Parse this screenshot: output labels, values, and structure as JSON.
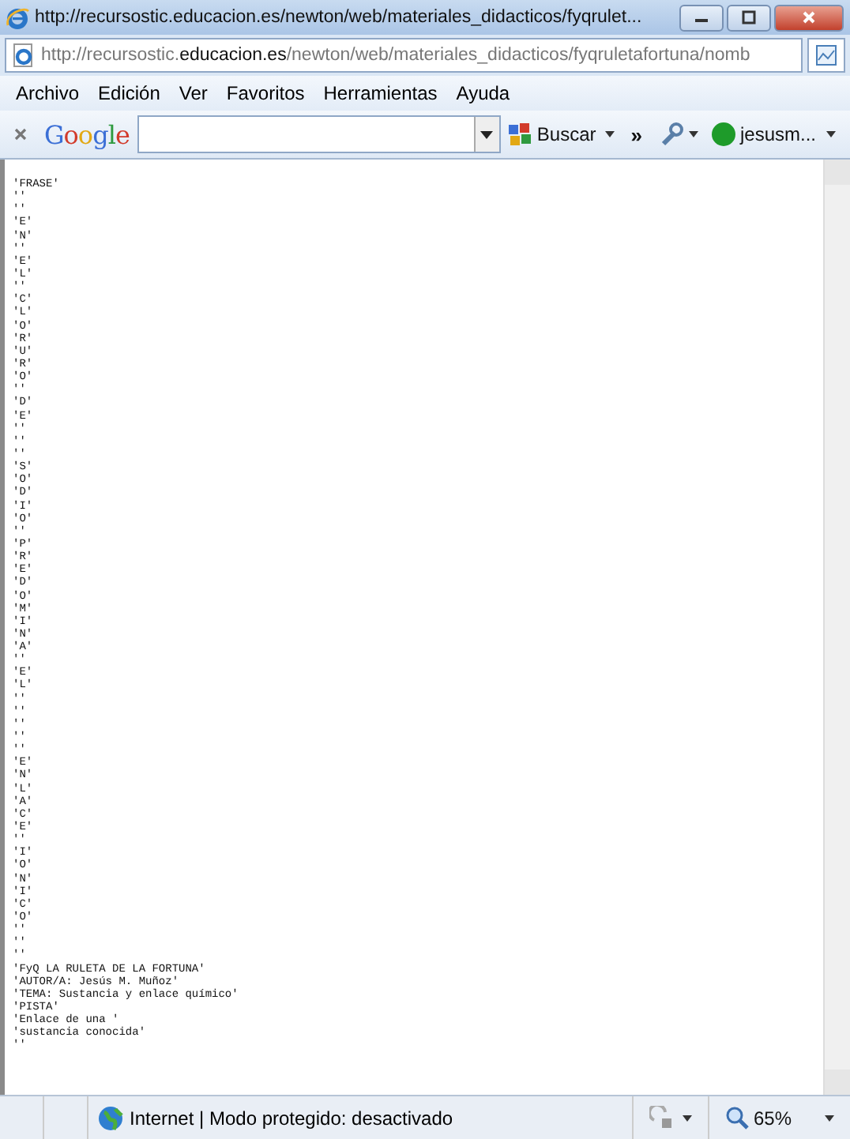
{
  "window": {
    "title": "http://recursostic.educacion.es/newton/web/materiales_didacticos/fyqrulet..."
  },
  "address_bar": {
    "prefix": "http://recursostic.",
    "domain": "educacion.es",
    "rest": "/newton/web/materiales_didacticos/fyqruletafortuna/nomb"
  },
  "menu": [
    "Archivo",
    "Edición",
    "Ver",
    "Favoritos",
    "Herramientas",
    "Ayuda"
  ],
  "google_toolbar": {
    "brand": "Google",
    "search_button": "Buscar",
    "chevron": "»",
    "profile": "jesusm..."
  },
  "document_lines": [
    "'FRASE'",
    "''",
    "''",
    "'E'",
    "'N'",
    "''",
    "'E'",
    "'L'",
    "''",
    "'C'",
    "'L'",
    "'O'",
    "'R'",
    "'U'",
    "'R'",
    "'O'",
    "''",
    "'D'",
    "'E'",
    "''",
    "''",
    "''",
    "'S'",
    "'O'",
    "'D'",
    "'I'",
    "'O'",
    "''",
    "'P'",
    "'R'",
    "'E'",
    "'D'",
    "'O'",
    "'M'",
    "'I'",
    "'N'",
    "'A'",
    "''",
    "'E'",
    "'L'",
    "''",
    "''",
    "''",
    "''",
    "''",
    "'E'",
    "'N'",
    "'L'",
    "'A'",
    "'C'",
    "'E'",
    "''",
    "'I'",
    "'O'",
    "'N'",
    "'I'",
    "'C'",
    "'O'",
    "''",
    "''",
    "''",
    "'FyQ LA RULETA DE LA FORTUNA'",
    "'AUTOR/A: Jesús M. Muñoz'",
    "'TEMA: Sustancia y enlace químico'",
    "'PISTA'",
    "'Enlace de una '",
    "'sustancia conocida'",
    "''"
  ],
  "status_bar": {
    "zone": "Internet | Modo protegido: desactivado",
    "zoom": "65%"
  }
}
